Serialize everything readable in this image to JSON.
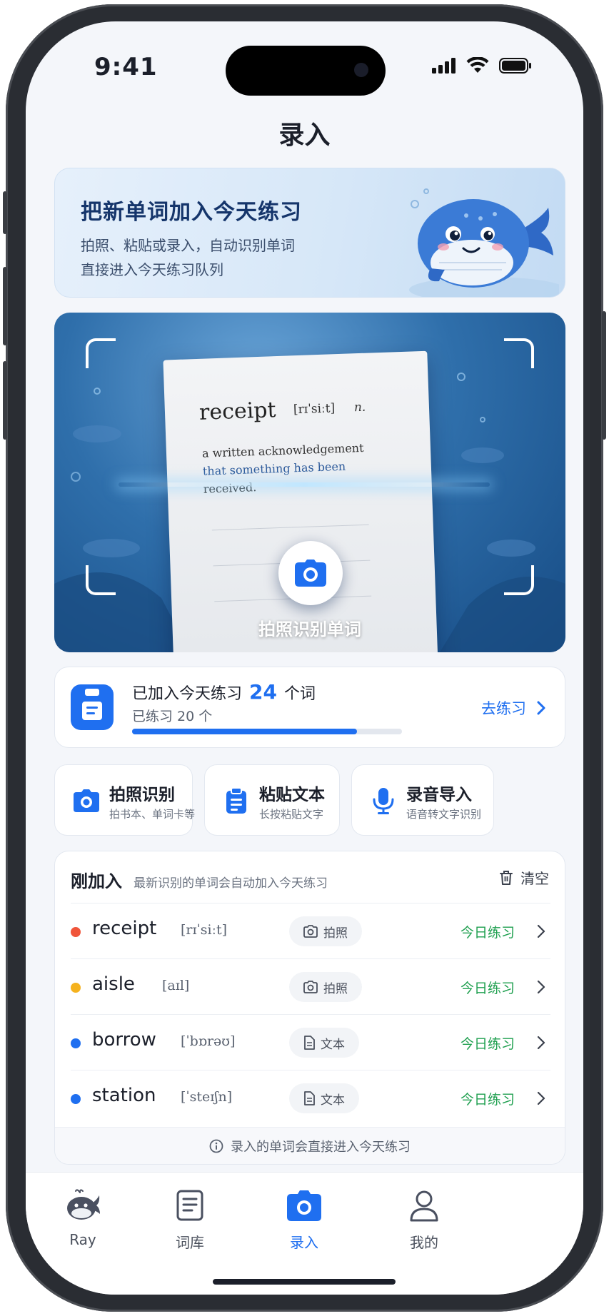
{
  "status_bar": {
    "time": "9:41"
  },
  "nav": {
    "title": "录入"
  },
  "hero": {
    "title": "把新单词加入今天练习",
    "line1": "拍照、粘贴或录入，自动识别单词",
    "line2": "直接进入今天练习队列"
  },
  "camera": {
    "sample_word": "receipt",
    "sample_ipa": "[rɪˈsiːt]",
    "sample_pos": "n.",
    "sample_def_1": "a written acknowledgement",
    "sample_def_2": "that something has been",
    "sample_def_3": "received.",
    "button_label": "拍照识别单词"
  },
  "progress": {
    "label": "已加入今天练习",
    "count": "24",
    "unit": "个词",
    "practiced": "已练习 20 个",
    "practiced_fraction": 0.833,
    "action": "去练习",
    "accent": "#1f6ff0"
  },
  "quick_actions": [
    {
      "title": "拍照识别",
      "subtitle": "拍书本、单词卡等",
      "icon": "camera-icon"
    },
    {
      "title": "粘贴文本",
      "subtitle": "长按粘贴文字",
      "icon": "clipboard-icon"
    },
    {
      "title": "录音导入",
      "subtitle": "语音转文字识别",
      "icon": "mic-icon"
    }
  ],
  "recent": {
    "title": "刚加入",
    "hint": "最新识别的单词会自动加入今天练习",
    "clear": "清空",
    "items": [
      {
        "word": "receipt",
        "ipa": "[rɪˈsiːt]",
        "source": "拍照",
        "source_icon": "camera-icon",
        "tag": "今日练习",
        "dot_color": "#f0553a"
      },
      {
        "word": "aisle",
        "ipa": "[aɪl]",
        "source": "拍照",
        "source_icon": "camera-icon",
        "tag": "今日练习",
        "dot_color": "#f5b21e"
      },
      {
        "word": "borrow",
        "ipa": "[ˈbɒrəʊ]",
        "source": "文本",
        "source_icon": "document-icon",
        "tag": "今日练习",
        "dot_color": "#1f6ff0"
      },
      {
        "word": "station",
        "ipa": "[ˈsteɪʃn]",
        "source": "文本",
        "source_icon": "document-icon",
        "tag": "今日练习",
        "dot_color": "#1f6ff0"
      }
    ],
    "footer": "录入的单词会直接进入今天练习"
  },
  "tabs": [
    {
      "label": "Ray",
      "icon": "whale-icon"
    },
    {
      "label": "词库",
      "icon": "book-icon"
    },
    {
      "label": "录入",
      "icon": "camera-icon",
      "active": true
    },
    {
      "label": "我的",
      "icon": "person-icon"
    }
  ],
  "colors": {
    "primary": "#1f6ff0",
    "success": "#20a050",
    "background": "#f4f6fa"
  }
}
